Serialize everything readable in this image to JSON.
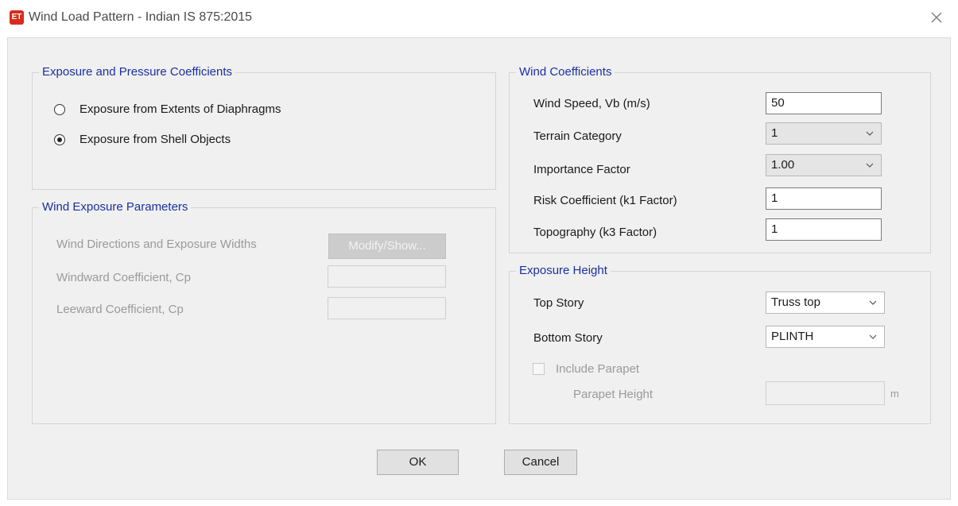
{
  "window": {
    "icon_text": "ET",
    "title": "Wind Load Pattern - Indian IS 875:2015"
  },
  "exposure_pressure": {
    "legend": "Exposure and Pressure Coefficients",
    "option_diaphragms": "Exposure from Extents of Diaphragms",
    "option_shell": "Exposure from Shell Objects",
    "selected": "option_shell"
  },
  "wind_exposure": {
    "legend": "Wind Exposure Parameters",
    "directions_label": "Wind Directions and Exposure Widths",
    "modify_button": "Modify/Show...",
    "windward_label": "Windward Coefficient, Cp",
    "windward_value": "",
    "leeward_label": "Leeward Coefficient, Cp",
    "leeward_value": ""
  },
  "wind_coefficients": {
    "legend": "Wind Coefficients",
    "wind_speed_label": "Wind Speed, Vb (m/s)",
    "wind_speed_value": "50",
    "terrain_label": "Terrain Category",
    "terrain_value": "1",
    "importance_label": "Importance Factor",
    "importance_value": "1.00",
    "risk_label": "Risk Coefficient (k1 Factor)",
    "risk_value": "1",
    "topography_label": "Topography (k3 Factor)",
    "topography_value": "1"
  },
  "exposure_height": {
    "legend": "Exposure Height",
    "top_story_label": "Top Story",
    "top_story_value": "Truss top",
    "bottom_story_label": "Bottom Story",
    "bottom_story_value": "PLINTH",
    "include_parapet_label": "Include Parapet",
    "include_parapet_checked": false,
    "parapet_height_label": "Parapet Height",
    "parapet_height_value": "",
    "parapet_unit": "m"
  },
  "buttons": {
    "ok": "OK",
    "cancel": "Cancel"
  },
  "colors": {
    "legend_text": "#1a2fa0",
    "dialog_bg": "#f0f0f0",
    "icon_bg": "#d92a1c"
  }
}
